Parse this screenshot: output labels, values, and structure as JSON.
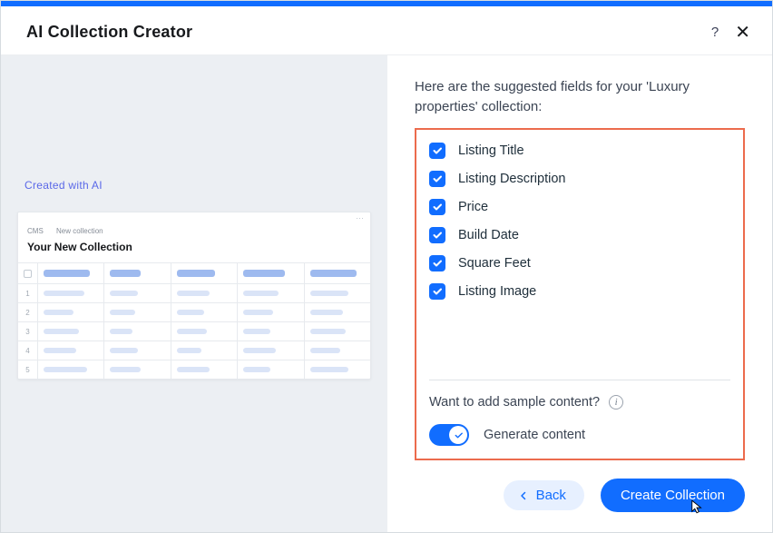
{
  "header": {
    "title": "AI Collection Creator"
  },
  "leftPanel": {
    "aiBadge": "Created with AI",
    "preview": {
      "breadcrumb1": "CMS",
      "breadcrumb2": "New collection",
      "title": "Your New Collection",
      "rows": [
        "1",
        "2",
        "3",
        "4",
        "5"
      ]
    }
  },
  "rightPanel": {
    "intro": "Here are the suggested fields for your 'Luxury properties' collection:",
    "fields": [
      {
        "label": "Listing Title",
        "checked": true
      },
      {
        "label": "Listing Description",
        "checked": true
      },
      {
        "label": "Price",
        "checked": true
      },
      {
        "label": "Build Date",
        "checked": true
      },
      {
        "label": "Square Feet",
        "checked": true
      },
      {
        "label": "Listing Image",
        "checked": true
      }
    ],
    "sampleContentLabel": "Want to add sample content?",
    "generateContentLabel": "Generate content"
  },
  "footer": {
    "backLabel": "Back",
    "createLabel": "Create Collection"
  }
}
